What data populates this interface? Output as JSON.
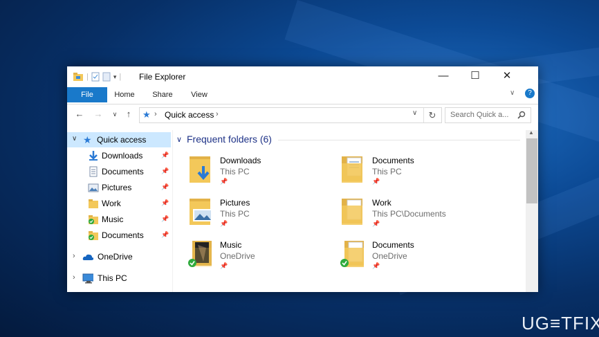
{
  "window": {
    "title": "File Explorer",
    "controls": {
      "minimize": "—",
      "maximize": "☐",
      "close": "✕"
    }
  },
  "ribbon": {
    "tabs": [
      "File",
      "Home",
      "Share",
      "View"
    ]
  },
  "address": {
    "path": [
      "Quick access"
    ],
    "search_placeholder": "Search Quick a..."
  },
  "nav": {
    "quick_access": "Quick access",
    "items": [
      {
        "label": "Downloads",
        "icon": "download-icon"
      },
      {
        "label": "Documents",
        "icon": "document-icon"
      },
      {
        "label": "Pictures",
        "icon": "pictures-icon"
      },
      {
        "label": "Work",
        "icon": "folder-icon"
      },
      {
        "label": "Music",
        "icon": "music-folder-icon"
      },
      {
        "label": "Documents",
        "icon": "onedrive-folder-icon"
      }
    ],
    "onedrive": "OneDrive",
    "this_pc": "This PC"
  },
  "content": {
    "group_title": "Frequent folders (6)",
    "folders": [
      {
        "name": "Downloads",
        "location": "This PC"
      },
      {
        "name": "Documents",
        "location": "This PC"
      },
      {
        "name": "Pictures",
        "location": "This PC"
      },
      {
        "name": "Work",
        "location": "This PC\\Documents"
      },
      {
        "name": "Music",
        "location": "OneDrive"
      },
      {
        "name": "Documents",
        "location": "OneDrive"
      }
    ]
  },
  "watermark": "UG≡TFIX",
  "colors": {
    "accent": "#1979ca",
    "folder": "#f3c85a",
    "sync_green": "#2faa3d"
  }
}
